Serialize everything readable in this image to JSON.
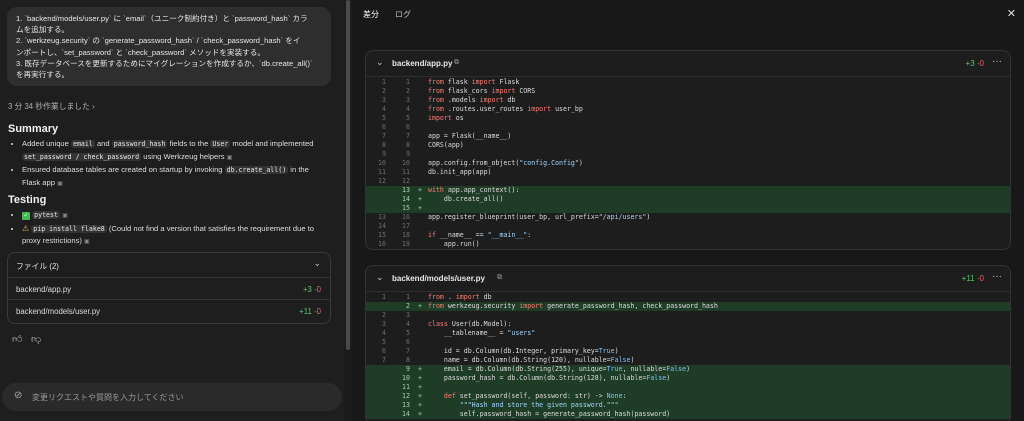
{
  "left": {
    "request_lines": [
      "1. `backend/models/user.py` に `email`（ユニーク制約付き）と `password_hash` カラ",
      "ムを追加する。",
      "2. `werkzeug.security` の `generate_password_hash` / `check_password_hash` をイ",
      "ンポートし、`set_password` と `check_password` メソッドを実装する。",
      "3. 既存データベースを更新するためにマイグレーションを作成するか、`db.create_all()`",
      "を再実行する。"
    ],
    "worked_label": "3 分 34 秒作業しました",
    "summary_title": "Summary",
    "summary_b1_p1": "Added unique ",
    "summary_b1_c1": "email",
    "summary_b1_p2": " and ",
    "summary_b1_c2": "password_hash",
    "summary_b1_p3": " fields to the ",
    "summary_b1_c3": "User",
    "summary_b1_p4": " model and implemented",
    "summary_b1_c4": "set_password / check_password",
    "summary_b1_p5": " using Werkzeug helpers",
    "summary_b2_p1": "Ensured database tables are created on startup by invoking ",
    "summary_b2_c1": "db.create_all()",
    "summary_b2_p2": " in the",
    "summary_b2_p3": "Flask app",
    "testing_title": "Testing",
    "test1_code": "pytest",
    "test2_code": "pip install flake8",
    "test2_note": " (Could not find a version that satisfies the requirement due to",
    "test2_note2": "proxy restrictions)",
    "files_header": "ファイル (2)",
    "files": [
      {
        "name": "backend/app.py",
        "add": "+3",
        "del": "-0"
      },
      {
        "name": "backend/models/user.py",
        "add": "+11",
        "del": "-0"
      }
    ],
    "input_placeholder": "変更リクエストや質問を入力してください"
  },
  "right": {
    "tabs": [
      "差分",
      "ログ"
    ],
    "files": [
      {
        "name": "backend/app.py",
        "add": "+3",
        "del": "-0",
        "lines": [
          {
            "o": "1",
            "n": "1",
            "t": "from flask import Flask"
          },
          {
            "o": "2",
            "n": "2",
            "t": "from flask_cors import CORS"
          },
          {
            "o": "3",
            "n": "3",
            "t": "from .models import db"
          },
          {
            "o": "4",
            "n": "4",
            "t": "from .routes.user_routes import user_bp"
          },
          {
            "o": "5",
            "n": "5",
            "t": "import os"
          },
          {
            "o": "6",
            "n": "6",
            "t": ""
          },
          {
            "o": "7",
            "n": "7",
            "t": "app = Flask(__name__)"
          },
          {
            "o": "8",
            "n": "8",
            "t": "CORS(app)"
          },
          {
            "o": "9",
            "n": "9",
            "t": ""
          },
          {
            "o": "10",
            "n": "10",
            "t": "app.config.from_object(\"config.Config\")"
          },
          {
            "o": "11",
            "n": "11",
            "t": "db.init_app(app)"
          },
          {
            "o": "12",
            "n": "12",
            "t": ""
          },
          {
            "o": "",
            "n": "13",
            "t": "with app.app_context():",
            "add": true
          },
          {
            "o": "",
            "n": "14",
            "t": "    db.create_all()",
            "add": true
          },
          {
            "o": "",
            "n": "15",
            "t": "",
            "add": true
          },
          {
            "o": "13",
            "n": "16",
            "t": "app.register_blueprint(user_bp, url_prefix=\"/api/users\")"
          },
          {
            "o": "14",
            "n": "17",
            "t": ""
          },
          {
            "o": "15",
            "n": "18",
            "t": "if __name__ == \"__main__\":"
          },
          {
            "o": "16",
            "n": "19",
            "t": "    app.run()"
          }
        ]
      },
      {
        "name": "backend/models/user.py",
        "add": "+11",
        "del": "-0",
        "lines": [
          {
            "o": "1",
            "n": "1",
            "t": "from . import db"
          },
          {
            "o": "",
            "n": "2",
            "t": "from werkzeug.security import generate_password_hash, check_password_hash",
            "add": true
          },
          {
            "o": "2",
            "n": "3",
            "t": ""
          },
          {
            "o": "3",
            "n": "4",
            "t": "class User(db.Model):"
          },
          {
            "o": "4",
            "n": "5",
            "t": "    __tablename__ = \"users\""
          },
          {
            "o": "5",
            "n": "6",
            "t": ""
          },
          {
            "o": "6",
            "n": "7",
            "t": "    id = db.Column(db.Integer, primary_key=True)"
          },
          {
            "o": "7",
            "n": "8",
            "t": "    name = db.Column(db.String(120), nullable=False)"
          },
          {
            "o": "",
            "n": "9",
            "t": "    email = db.Column(db.String(255), unique=True, nullable=False)",
            "add": true
          },
          {
            "o": "",
            "n": "10",
            "t": "    password_hash = db.Column(db.String(128), nullable=False)",
            "add": true
          },
          {
            "o": "",
            "n": "11",
            "t": "",
            "add": true
          },
          {
            "o": "",
            "n": "12",
            "t": "    def set_password(self, password: str) -> None:",
            "add": true
          },
          {
            "o": "",
            "n": "13",
            "t": "        \"\"\"Hash and store the given password.\"\"\"",
            "add": true
          },
          {
            "o": "",
            "n": "14",
            "t": "        self.password_hash = generate_password_hash(password)",
            "add": true
          }
        ]
      }
    ]
  }
}
